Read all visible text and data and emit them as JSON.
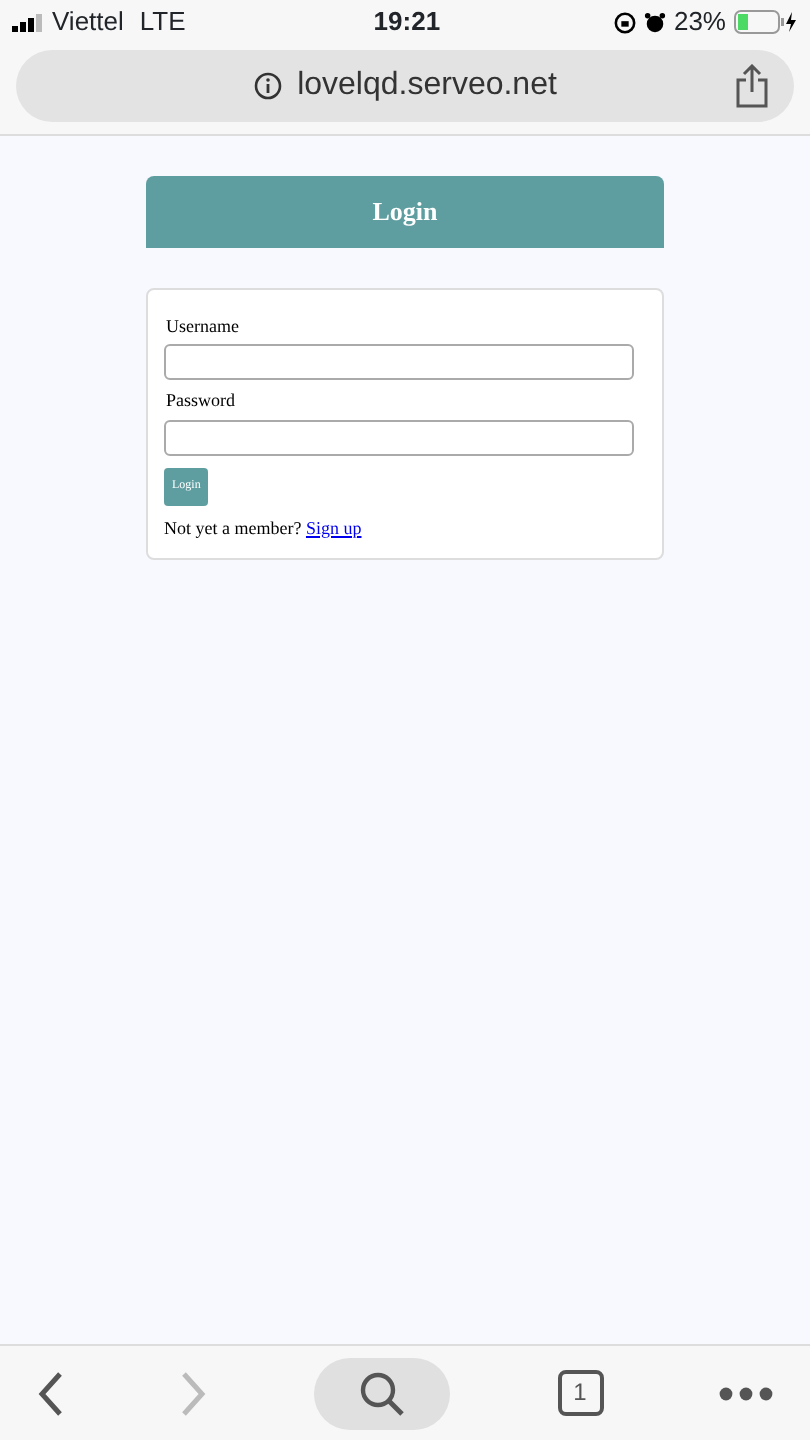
{
  "status_bar": {
    "carrier": "Viettel",
    "network": "LTE",
    "time": "19:21",
    "battery": "23%"
  },
  "address_bar": {
    "url": "lovelqd.serveo.net"
  },
  "page": {
    "header": "Login",
    "fields": [
      {
        "label": "Username"
      },
      {
        "label": "Password"
      }
    ],
    "submit": "Login",
    "signup_prompt": "Not yet a member?",
    "signup_link": "Sign up"
  },
  "toolbar": [
    {
      "kind": "back",
      "disabled": false
    },
    {
      "kind": "forward",
      "disabled": true
    },
    {
      "kind": "search",
      "disabled": false
    },
    {
      "kind": "tabs",
      "label": "1",
      "disabled": false
    },
    {
      "kind": "more",
      "disabled": false
    }
  ]
}
